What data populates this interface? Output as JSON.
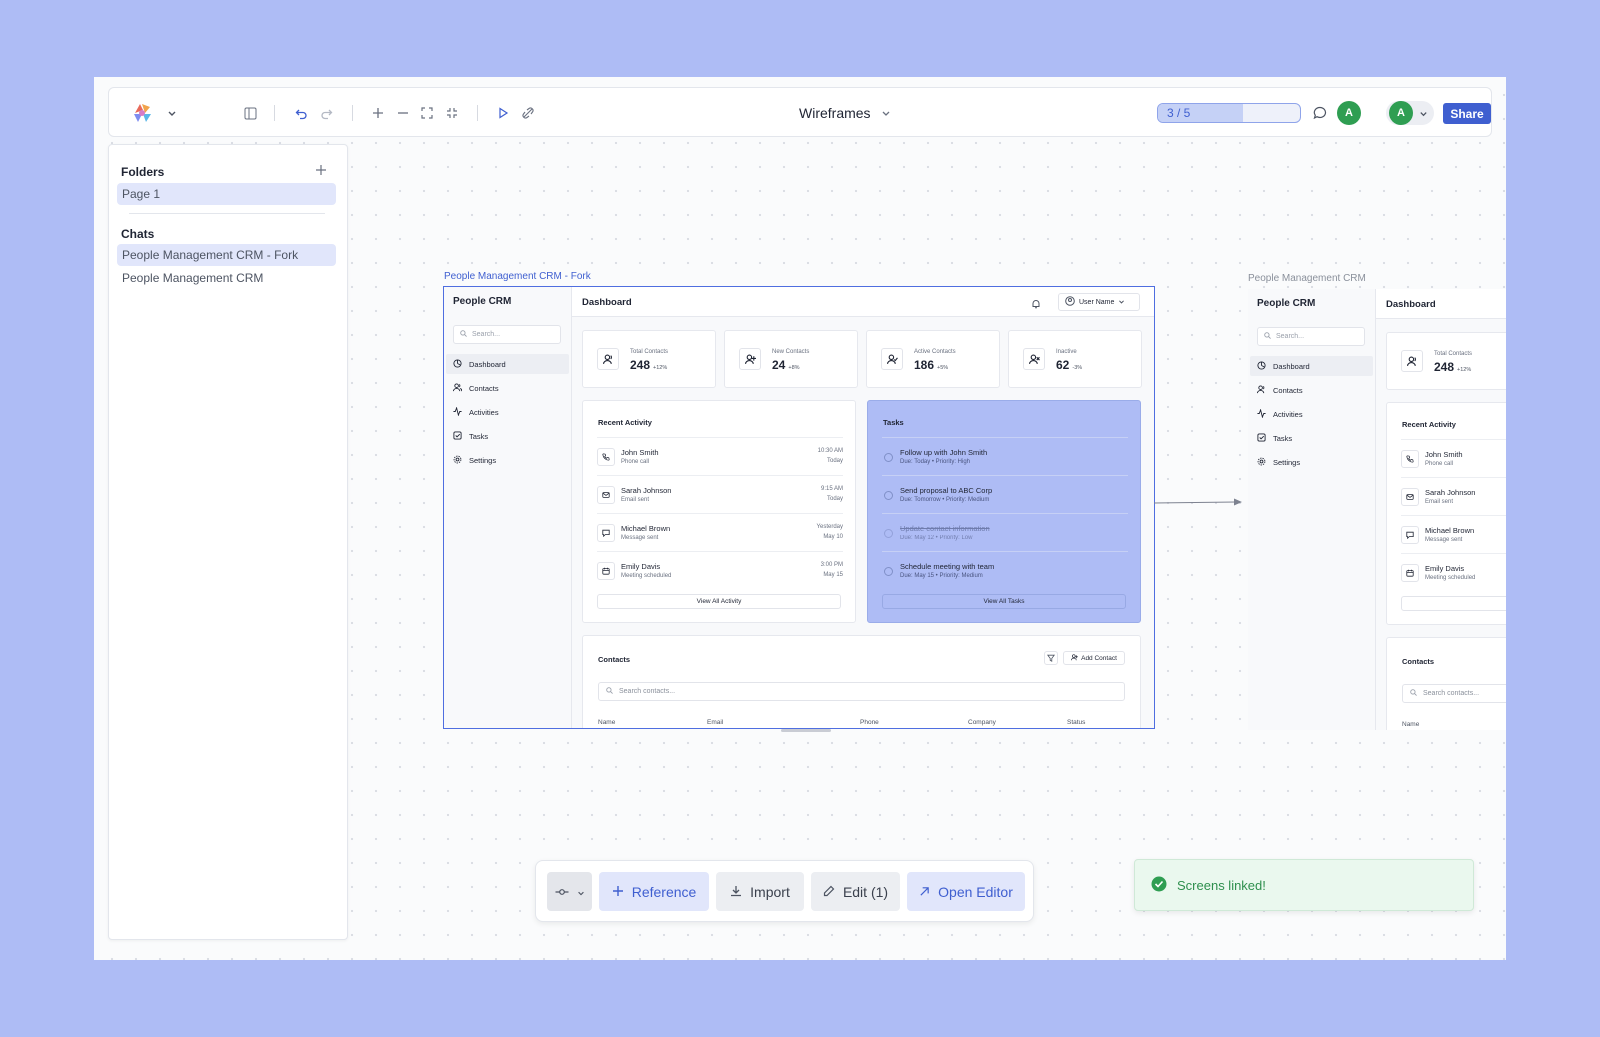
{
  "toolbar": {
    "doc_title": "Wireframes",
    "progress_label": "3 / 5",
    "progress_fraction": 0.6,
    "avatar_initial": "A",
    "user_initial": "A",
    "share_label": "Share"
  },
  "sidebar": {
    "folders_heading": "Folders",
    "folders": [
      {
        "label": "Page 1",
        "active": true
      }
    ],
    "chats_heading": "Chats",
    "chats": [
      {
        "label": "People Management CRM - Fork",
        "active": true
      },
      {
        "label": "People Management CRM",
        "active": false
      }
    ]
  },
  "frames": [
    {
      "label": "People Management CRM - Fork",
      "selected": true
    },
    {
      "label": "People Management CRM",
      "selected": false
    }
  ],
  "crm": {
    "app_name": "People CRM",
    "search_placeholder": "Search...",
    "page_title": "Dashboard",
    "user_name": "User Name",
    "nav": [
      {
        "label": "Dashboard",
        "icon": "dashboard-icon",
        "active": true
      },
      {
        "label": "Contacts",
        "icon": "users-icon"
      },
      {
        "label": "Activities",
        "icon": "activity-icon"
      },
      {
        "label": "Tasks",
        "icon": "checkbox-icon"
      },
      {
        "label": "Settings",
        "icon": "gear-icon"
      }
    ],
    "stats": [
      {
        "label": "Total Contacts",
        "value": "248",
        "change": "+12%",
        "icon": "users-icon"
      },
      {
        "label": "New Contacts",
        "value": "24",
        "change": "+8%",
        "icon": "user-plus-icon"
      },
      {
        "label": "Active Contacts",
        "value": "186",
        "change": "+5%",
        "icon": "user-check-icon"
      },
      {
        "label": "Inactive",
        "value": "62",
        "change": "-3%",
        "icon": "user-x-icon"
      }
    ],
    "recent_activity": {
      "title": "Recent Activity",
      "button": "View All Activity",
      "items": [
        {
          "name": "John Smith",
          "type": "Phone call",
          "time": "10:30 AM",
          "date": "Today",
          "icon": "phone-icon"
        },
        {
          "name": "Sarah Johnson",
          "type": "Email sent",
          "time": "9:15 AM",
          "date": "Today",
          "icon": "mail-icon"
        },
        {
          "name": "Michael Brown",
          "type": "Message sent",
          "time": "Yesterday",
          "date": "May 10",
          "icon": "message-icon"
        },
        {
          "name": "Emily Davis",
          "type": "Meeting scheduled",
          "time": "3:00 PM",
          "date": "May 15",
          "icon": "calendar-icon"
        }
      ]
    },
    "tasks": {
      "title": "Tasks",
      "button": "View All Tasks",
      "items": [
        {
          "title": "Follow up with John Smith",
          "meta": "Due: Today  •  Priority: High",
          "done": false
        },
        {
          "title": "Send proposal to ABC Corp",
          "meta": "Due: Tomorrow  •  Priority: Medium",
          "done": false
        },
        {
          "title": "Update contact information",
          "meta": "Due: May 12  •  Priority: Low",
          "done": true
        },
        {
          "title": "Schedule meeting with team",
          "meta": "Due: May 15  •  Priority: Medium",
          "done": false
        }
      ]
    },
    "contacts": {
      "title": "Contacts",
      "add_label": "Add Contact",
      "search_placeholder": "Search contacts...",
      "columns": [
        "Name",
        "Email",
        "Phone",
        "Company",
        "Status"
      ]
    }
  },
  "bottombar": {
    "reference_label": "Reference",
    "import_label": "Import",
    "edit_label": "Edit (1)",
    "open_label": "Open Editor"
  },
  "toast": {
    "message": "Screens linked!"
  },
  "colors": {
    "accent": "#3f5fd0",
    "canvas_bg": "#aebcf5",
    "success": "#2f8f4e"
  }
}
